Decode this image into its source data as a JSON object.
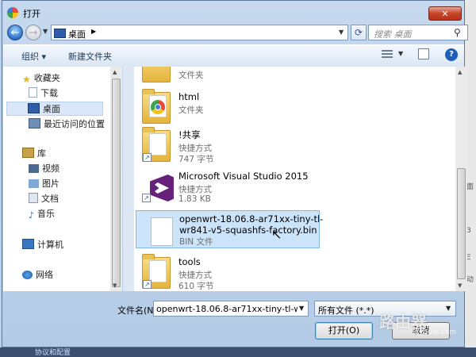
{
  "window": {
    "title": "打开",
    "close_label": "✕"
  },
  "nav": {
    "back_glyph": "←",
    "forward_glyph": "→",
    "address": "桌面",
    "search_placeholder": "搜索 桌面"
  },
  "toolbar": {
    "organize": "组织 ▾",
    "new_folder": "新建文件夹"
  },
  "sidebar": {
    "favorites": {
      "label": "收藏夹",
      "items": [
        {
          "label": "下载"
        },
        {
          "label": "桌面"
        },
        {
          "label": "最近访问的位置"
        }
      ]
    },
    "libraries": {
      "label": "库",
      "items": [
        {
          "label": "视频"
        },
        {
          "label": "图片"
        },
        {
          "label": "文档"
        },
        {
          "label": "音乐"
        }
      ]
    },
    "computer": "计算机",
    "network": "网络"
  },
  "files": [
    {
      "name": "",
      "type": "文件夹",
      "size": "",
      "icon": "folder-icon"
    },
    {
      "name": "html",
      "type": "文件夹",
      "size": "",
      "icon": "chrome-folder-icon"
    },
    {
      "name": "!共享",
      "type": "快捷方式",
      "size": "747 字节",
      "icon": "shortcut-folder-icon"
    },
    {
      "name": "Microsoft Visual Studio 2015",
      "type": "快捷方式",
      "size": "1.83 KB",
      "icon": "visual-studio-icon"
    },
    {
      "name": "openwrt-18.06.8-ar71xx-tiny-tl-\nwr841-v5-squashfs-factory.bin",
      "type": "BIN 文件",
      "size": "",
      "icon": "bin-file-icon",
      "selected": true
    },
    {
      "name": "tools",
      "type": "快捷方式",
      "size": "610 字节",
      "icon": "shortcut-folder-icon"
    }
  ],
  "footer": {
    "filename_label": "文件名(N):",
    "filename_value": "openwrt-18.06.8-ar71xx-tiny-tl-w",
    "filetype_value": "所有文件 (*.*)",
    "open_label": "打开(O)",
    "cancel_label": "取消"
  },
  "watermark": {
    "text": "路由器",
    "sub": "luyouqi.com"
  },
  "taskbar_text": "协议和配置"
}
